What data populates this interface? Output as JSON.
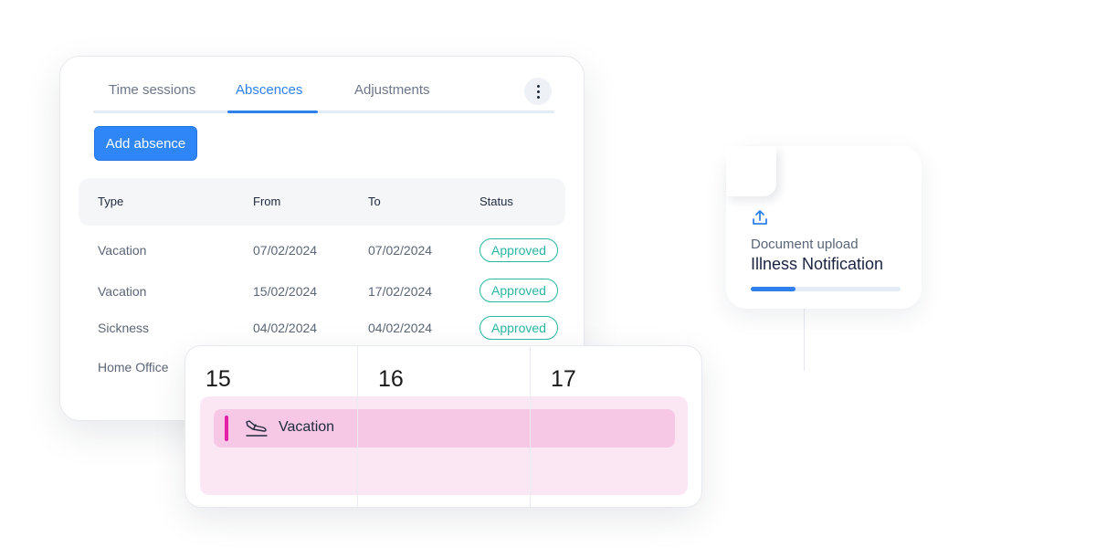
{
  "tabs": [
    {
      "label": "Time sessions",
      "active": false
    },
    {
      "label": "Abscences",
      "active": true
    },
    {
      "label": "Adjustments",
      "active": false
    }
  ],
  "menu": {
    "icon": "more-vertical-icon"
  },
  "add_button": {
    "label": "Add absence"
  },
  "table": {
    "headers": {
      "type": "Type",
      "from": "From",
      "to": "To",
      "status": "Status"
    },
    "rows": [
      {
        "type": "Vacation",
        "from": "07/02/2024",
        "to": "07/02/2024",
        "status": "Approved"
      },
      {
        "type": "Vacation",
        "from": "15/02/2024",
        "to": "17/02/2024",
        "status": "Approved"
      },
      {
        "type": "Sickness",
        "from": "04/02/2024",
        "to": "04/02/2024",
        "status": "Approved"
      },
      {
        "type": "Home Office"
      }
    ]
  },
  "calendar": {
    "days": [
      "15",
      "16",
      "17"
    ],
    "event": {
      "label": "Vacation",
      "icon": "airplane-landing-icon"
    }
  },
  "document": {
    "icon": "upload-icon",
    "label": "Document upload",
    "name": "Illness Notification",
    "progress": 0.3
  },
  "colors": {
    "accent": "#2f80ed",
    "approved": "#2bb6a3",
    "event_bar": "#e21fa6",
    "event_bg": "#f6c8e6"
  }
}
